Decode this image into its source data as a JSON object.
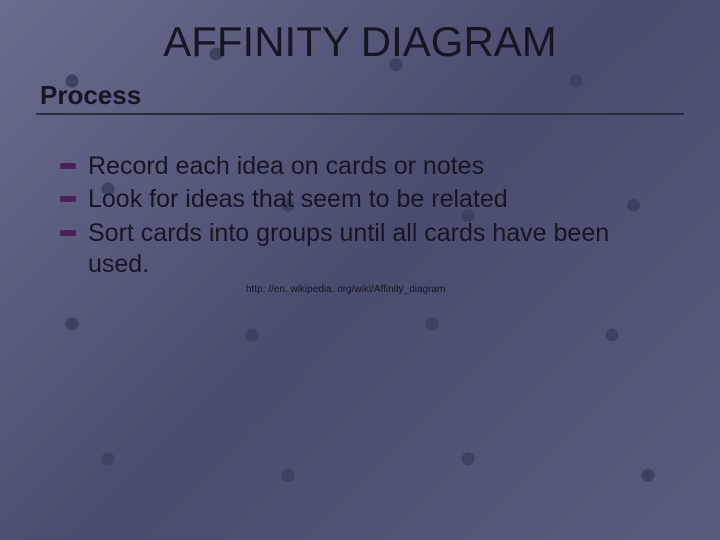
{
  "title": "AFFINITY DIAGRAM",
  "subhead": "Process",
  "bullets": [
    "Record each idea on cards or notes",
    "Look for ideas that seem to be related",
    "Sort cards into groups until all cards have been used."
  ],
  "citation": "http: //en. wikipedia. org/wiki/Affinity_diagram"
}
